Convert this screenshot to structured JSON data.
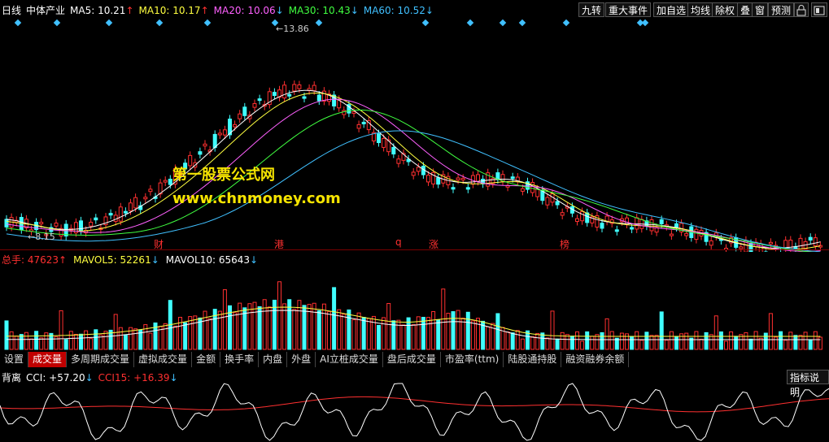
{
  "header": {
    "period": "日线",
    "stock": "中体产业",
    "ma": [
      {
        "label": "MA5: 10.21",
        "arrow": "↑",
        "color": "#ffffff"
      },
      {
        "label": "MA10: 10.17",
        "arrow": "↑",
        "color": "#ffff40"
      },
      {
        "label": "MA20: 10.06",
        "arrow": "↓",
        "color": "#ff60ff"
      },
      {
        "label": "MA30: 10.43",
        "arrow": "↓",
        "color": "#40ff40"
      },
      {
        "label": "MA60: 10.52",
        "arrow": "↓",
        "color": "#40c0ff"
      }
    ],
    "buttons": [
      "九转",
      "重大事件",
      "加自选",
      "均线",
      "除权",
      "叠",
      "窗",
      "预测"
    ]
  },
  "price_chart": {
    "high_label": "13.86",
    "low_label": "8.15",
    "event_markers": [
      "财",
      "港",
      "q",
      "涨",
      "榜"
    ],
    "watermark_cn": "第一股票公式网",
    "watermark_url": "www.chnmoney.com",
    "colors": {
      "up": "#ff3030",
      "down": "#40ffff",
      "ma5": "#ffffff",
      "ma10": "#ffff40",
      "ma20": "#ff60ff",
      "ma30": "#40ff40",
      "ma60": "#40c0ff"
    }
  },
  "volume": {
    "total_label": "总手: 47623",
    "total_arrow": "↑",
    "mavol5_label": "MAVOL5: 52261",
    "mavol5_arrow": "↓",
    "mavol10_label": "MAVOL10: 65643",
    "mavol10_arrow": "↓"
  },
  "tabs": [
    "设置",
    "成交量",
    "多周期成交量",
    "虚拟成交量",
    "金额",
    "换手率",
    "内盘",
    "外盘",
    "AI立桩成交量",
    "盘后成交量",
    "市盈率(ttm)",
    "陆股通持股",
    "融资融券余额"
  ],
  "active_tab": "成交量",
  "cci": {
    "name": "背离",
    "cci_label": "CCI: +57.20",
    "cci_arrow": "↓",
    "cci15_label": "CCI15: +16.39",
    "cci15_arrow": "↓",
    "help_button": "指标说明"
  }
}
